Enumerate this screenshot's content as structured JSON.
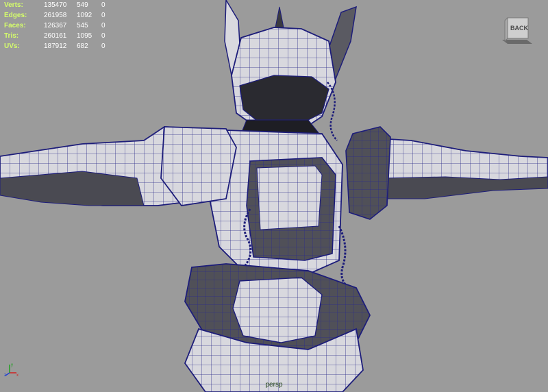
{
  "hud": {
    "rows": [
      {
        "label": "Verts:",
        "total": "135470",
        "selected": "549",
        "extra": "0"
      },
      {
        "label": "Edges:",
        "total": "261958",
        "selected": "1092",
        "extra": "0"
      },
      {
        "label": "Faces:",
        "total": "126367",
        "selected": "545",
        "extra": "0"
      },
      {
        "label": "Tris:",
        "total": "260161",
        "selected": "1095",
        "extra": "0"
      },
      {
        "label": "UVs:",
        "total": "187912",
        "selected": "682",
        "extra": "0"
      }
    ]
  },
  "viewcube": {
    "label": "BACK"
  },
  "axis": {
    "x_label": "x",
    "y_label": "y",
    "z_label": "z"
  },
  "camera": {
    "name": "persp"
  },
  "colors": {
    "background": "#9b9b9b",
    "hud_label": "#d6ff6a",
    "wire": "#1d1d7a",
    "mesh_light": "#e9e9ee",
    "mesh_dark": "#3c3c44"
  },
  "icons": {
    "viewcube": "view-cube-icon",
    "axis": "axis-gizmo-icon"
  }
}
